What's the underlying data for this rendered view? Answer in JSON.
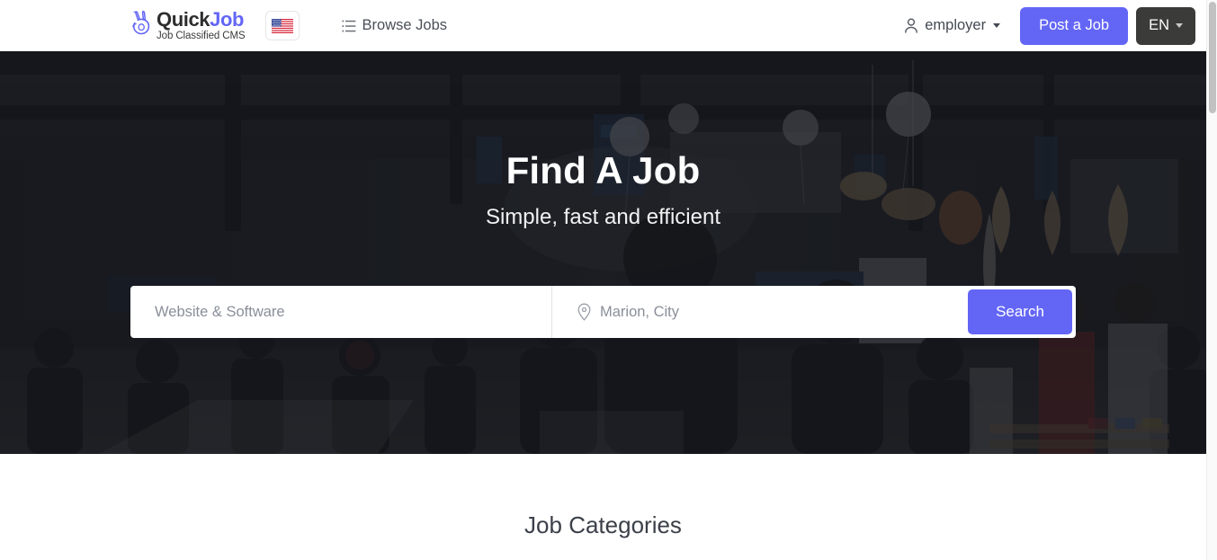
{
  "header": {
    "logo": {
      "mark_icon": "peace-hand-icon",
      "title_primary": "Quick",
      "title_accent": "Job",
      "tagline": "Job Classified CMS"
    },
    "language_flag": {
      "icon": "us-flag-icon",
      "label": "US"
    },
    "browse_jobs": {
      "icon": "list-icon",
      "label": "Browse Jobs"
    },
    "account": {
      "icon": "person-icon",
      "label": "employer",
      "caret_icon": "chevron-down-icon"
    },
    "post_job_label": "Post a Job",
    "language": {
      "label": "EN",
      "caret_icon": "chevron-down-icon"
    }
  },
  "hero": {
    "title": "Find A Job",
    "subtitle": "Simple, fast and efficient",
    "search": {
      "keyword_placeholder": "Website & Software",
      "keyword_value": "",
      "location_icon": "map-pin-icon",
      "location_placeholder": "Marion, City",
      "location_value": "",
      "button_label": "Search"
    }
  },
  "categories": {
    "title": "Job Categories"
  },
  "colors": {
    "accent": "#6366f5",
    "dark_button": "#3b3b39",
    "heading": "#3b4049",
    "placeholder": "#8a8f99"
  }
}
